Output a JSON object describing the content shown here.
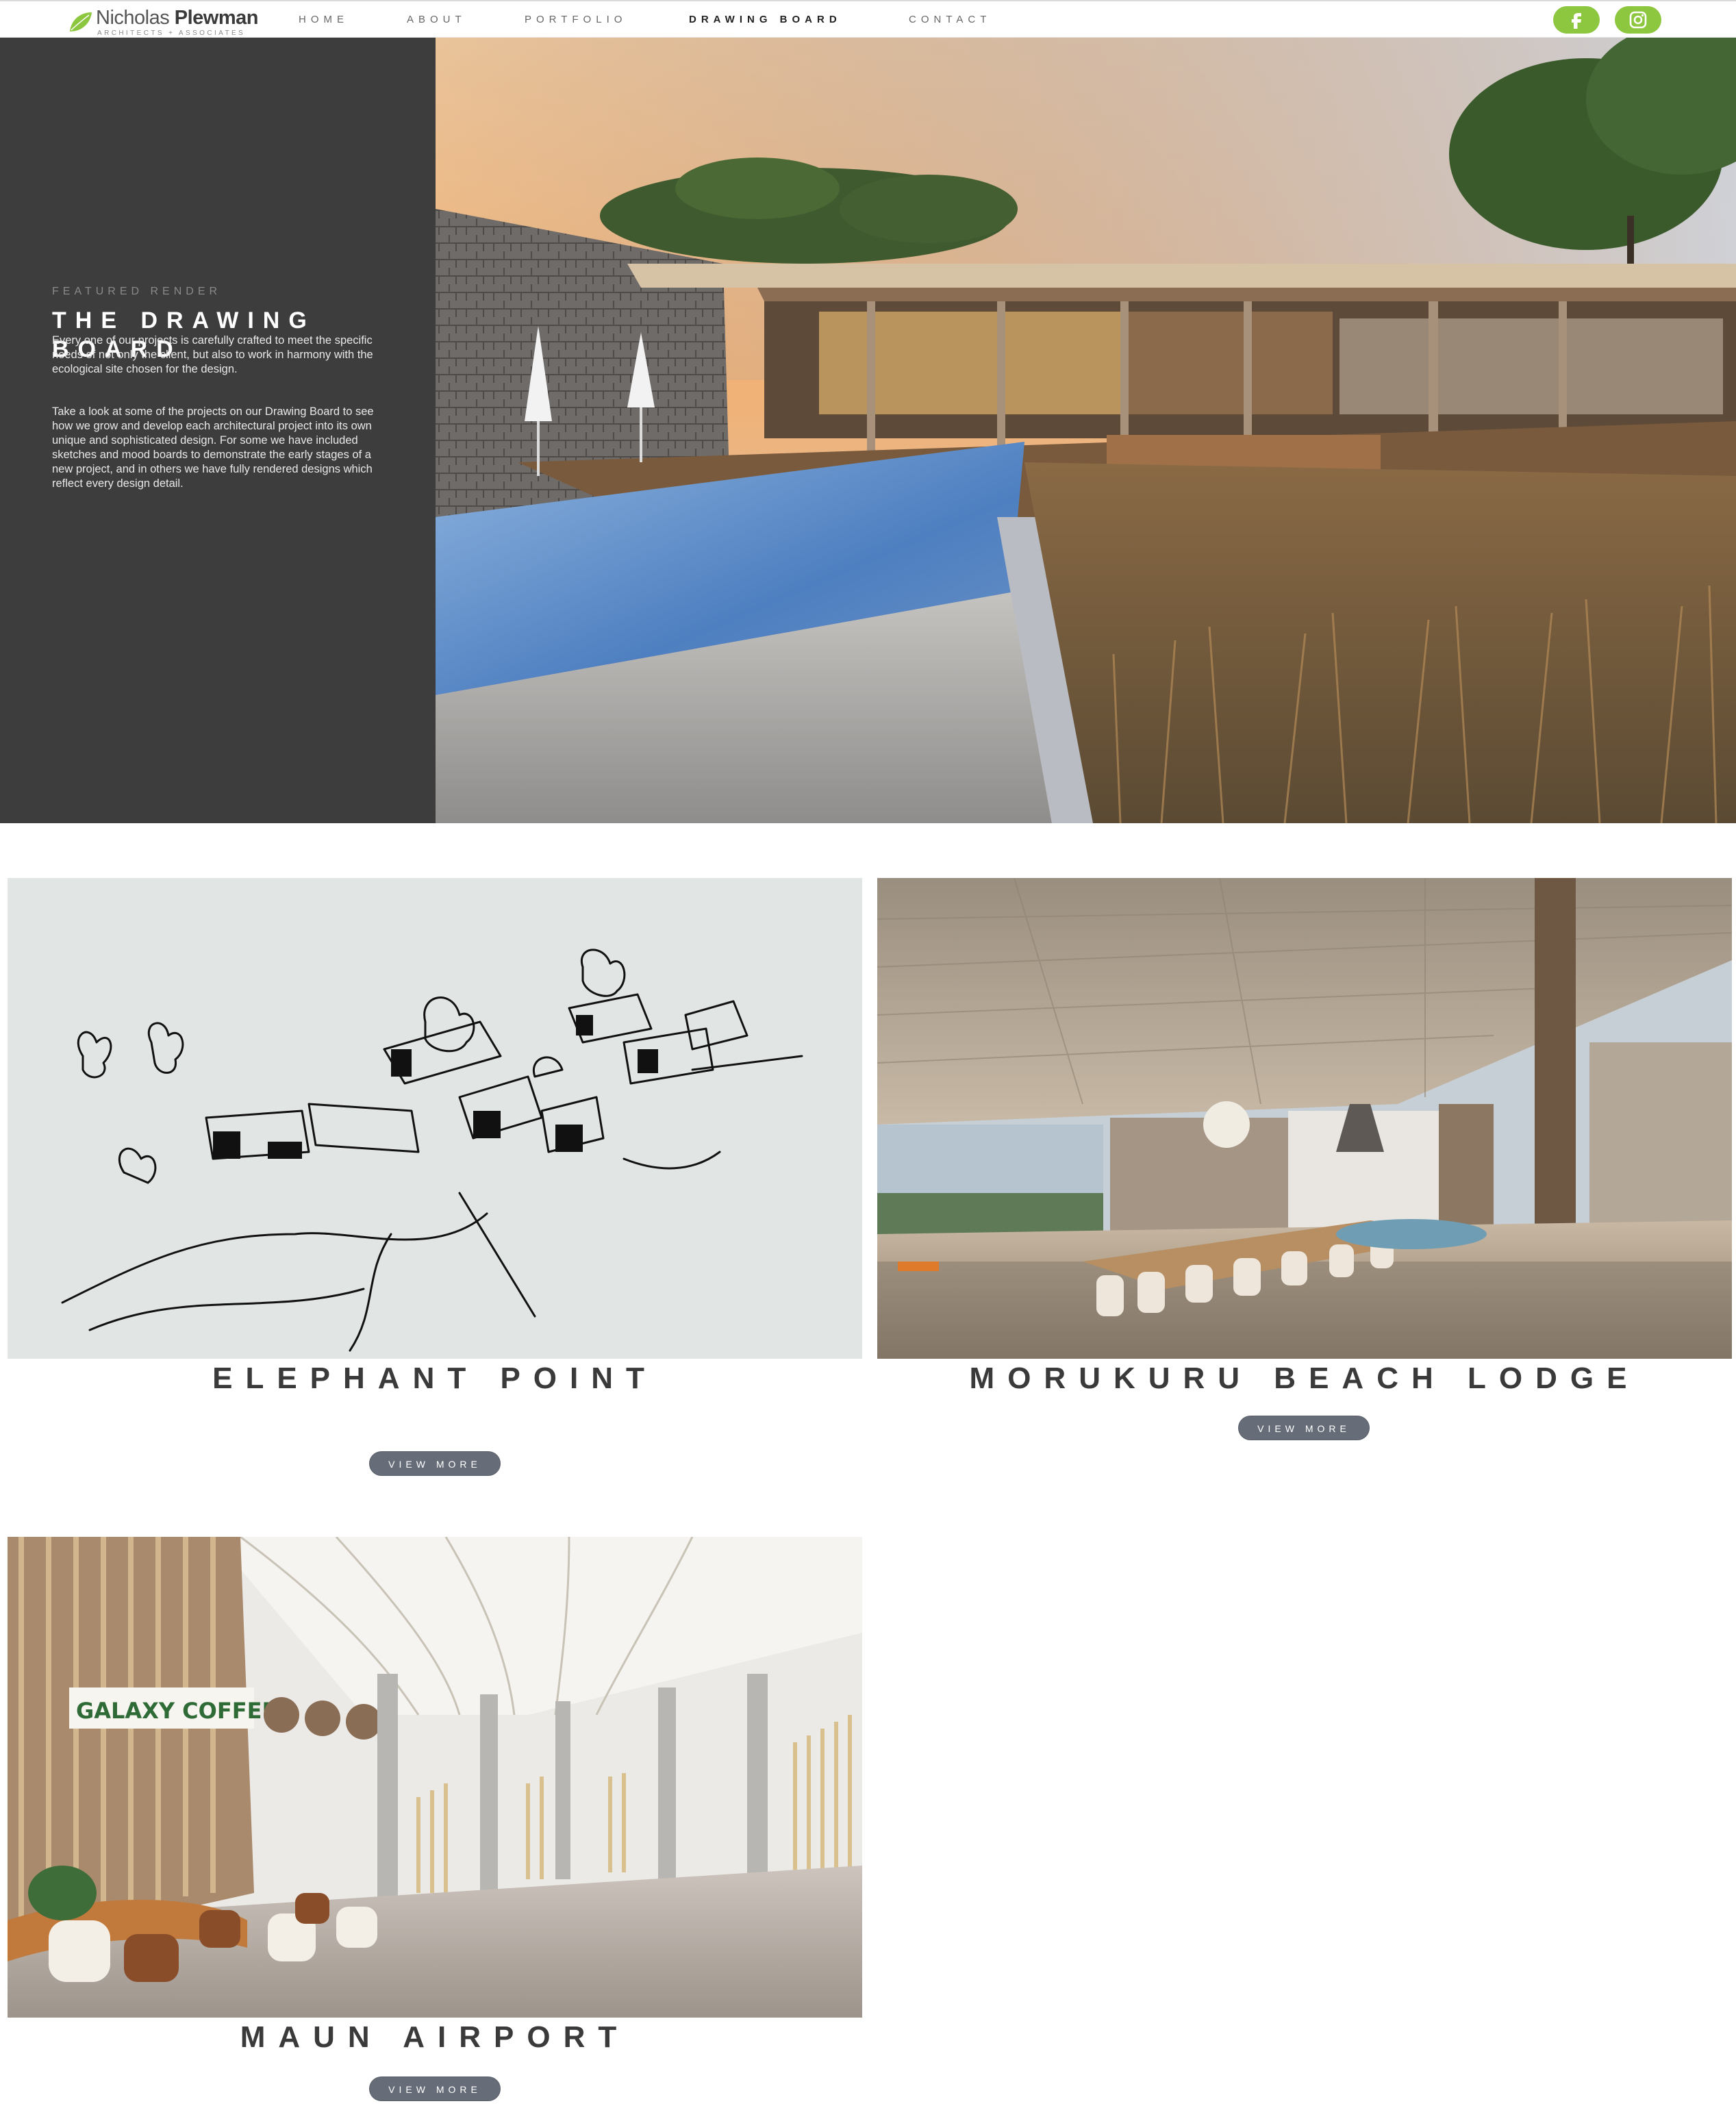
{
  "brand": {
    "name_light": "Nicholas",
    "name_bold": "Plewman",
    "tagline": "ARCHITECTS + ASSOCIATES",
    "accent_color": "#8dc63f"
  },
  "nav": {
    "items": [
      {
        "label": "HOME"
      },
      {
        "label": "ABOUT"
      },
      {
        "label": "PORTFOLIO"
      },
      {
        "label": "DRAWING BOARD",
        "active": true
      },
      {
        "label": "CONTACT"
      }
    ]
  },
  "social": {
    "facebook_icon": "facebook-icon",
    "instagram_icon": "instagram-icon"
  },
  "hero": {
    "eyebrow": "FEATURED RENDER",
    "title": "THE DRAWING BOARD",
    "paragraph1": "Every one of our projects is carefully crafted to meet the specific needs of not only the client, but also to work in harmony with the ecological site chosen for the design.",
    "paragraph2": "Take a look at some of the projects on our Drawing Board to see how we grow and develop each architectural project into its own unique and sophisticated design. For some we have included sketches and mood boards to demonstrate the early stages of a new project, and in others we have fully rendered designs which reflect every design detail."
  },
  "projects": [
    {
      "title": "ELEPHANT POINT",
      "button": "VIEW MORE",
      "image": "architectural sketch"
    },
    {
      "title": "MORUKURU BEACH LODGE",
      "button": "VIEW MORE",
      "image": "lodge interior render"
    },
    {
      "title": "MAUN AIRPORT",
      "button": "VIEW MORE",
      "image": "airport terminal render",
      "sign_text": "GALAXY COFFEE"
    }
  ]
}
